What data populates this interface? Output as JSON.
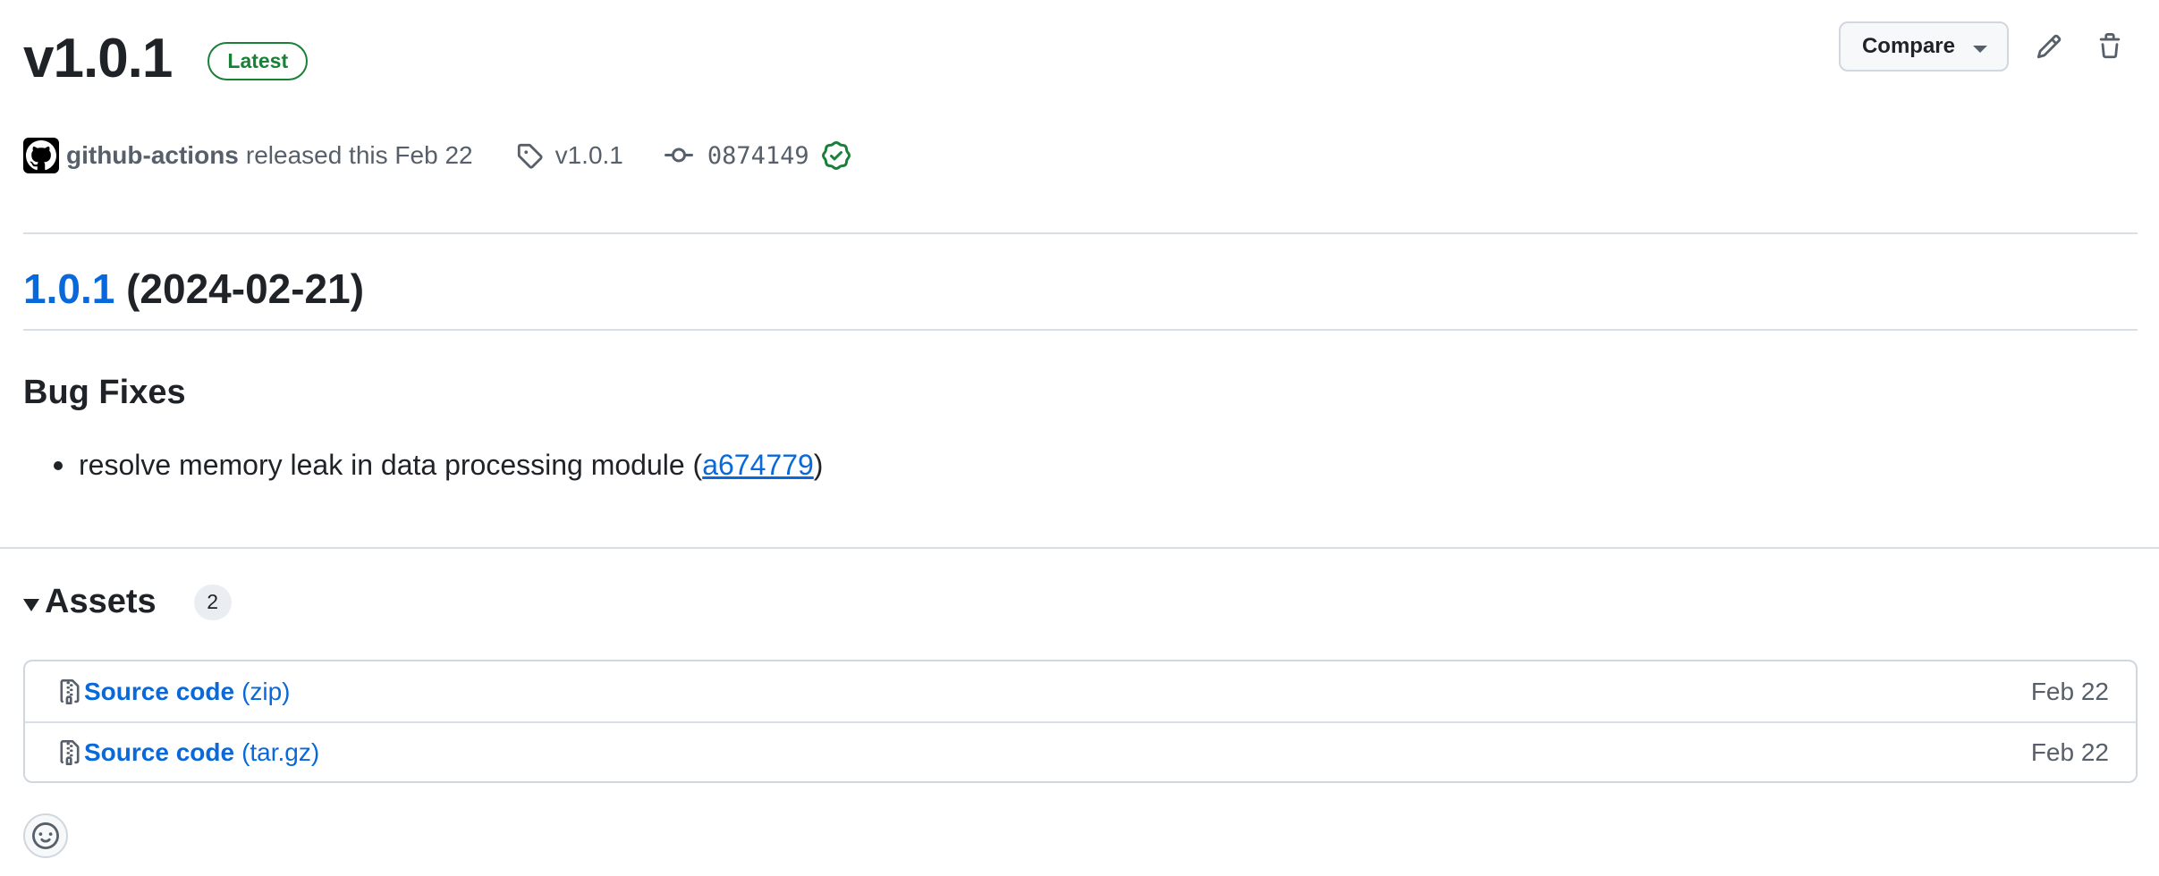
{
  "release": {
    "title": "v1.0.1",
    "badge": "Latest",
    "author": "github-actions",
    "released_text": "released this Feb 22",
    "tag": "v1.0.1",
    "commit": "0874149"
  },
  "actions": {
    "compare_label": "Compare"
  },
  "notes": {
    "version_link": "1.0.1",
    "version_date": "(2024-02-21)",
    "section": "Bug Fixes",
    "items": [
      {
        "text": "resolve memory leak in data processing module (",
        "link": "a674779",
        "suffix": ")"
      }
    ]
  },
  "assets": {
    "title": "Assets",
    "count": "2",
    "items": [
      {
        "name": "Source code",
        "ext": "(zip)",
        "date": "Feb 22"
      },
      {
        "name": "Source code",
        "ext": "(tar.gz)",
        "date": "Feb 22"
      }
    ]
  },
  "colors": {
    "link": "#0969da",
    "success": "#1a7f37",
    "muted": "#57606a"
  },
  "icons": [
    "github-mark-icon",
    "tag-icon",
    "git-commit-icon",
    "verified-check-icon",
    "pencil-icon",
    "trash-icon",
    "file-zip-icon",
    "smiley-icon"
  ]
}
